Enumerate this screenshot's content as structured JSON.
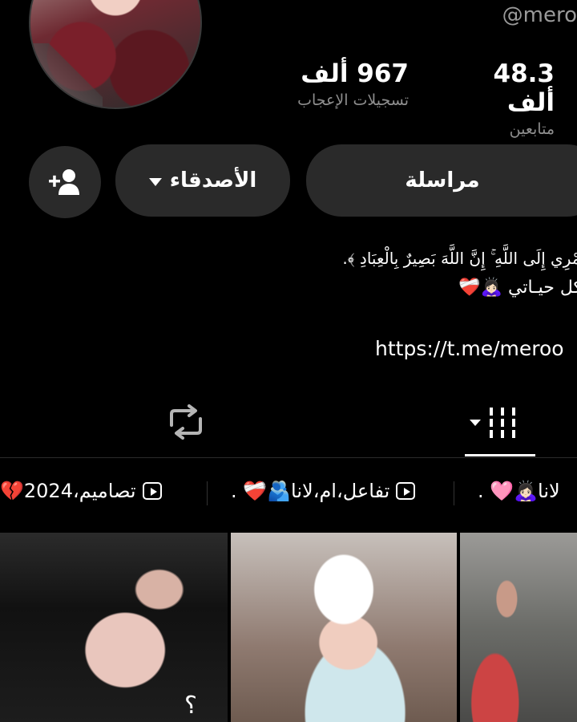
{
  "profile": {
    "username": "@mero",
    "stats": [
      {
        "value": "48.3 ألف",
        "label": "متابعين"
      },
      {
        "value": "967 ألف",
        "label": "تسجيلات الإعجاب"
      }
    ]
  },
  "actions": {
    "message_label": "مراسلة",
    "friends_label": "الأصدقاء"
  },
  "bio": {
    "line1": "أُمْرِي إِلَى اللَّهِ ۚ إِنَّ اللَّهَ بَصِيرٌ بِالْعِبَادِ ﴾.",
    "line2": "كل حيـاتي 🙇🏻‍♀️❤️‍🩹",
    "link": "https://t.me/meroo"
  },
  "playlists": [
    {
      "label": "تصاميم،2024💔"
    },
    {
      "label": "تفاعل،ام،لانا🫂❤️‍🩹 ."
    },
    {
      "label": "لانا🙇🏻‍♀️🩷 ."
    }
  ],
  "thumbnails": [
    {
      "overlay_text": "؟"
    }
  ],
  "icons": {
    "add_friend": "add-user-icon",
    "caret": "caret-down-icon",
    "videos_tab": "grid-icon",
    "reposts_tab": "repost-icon",
    "playlist": "play-icon"
  }
}
